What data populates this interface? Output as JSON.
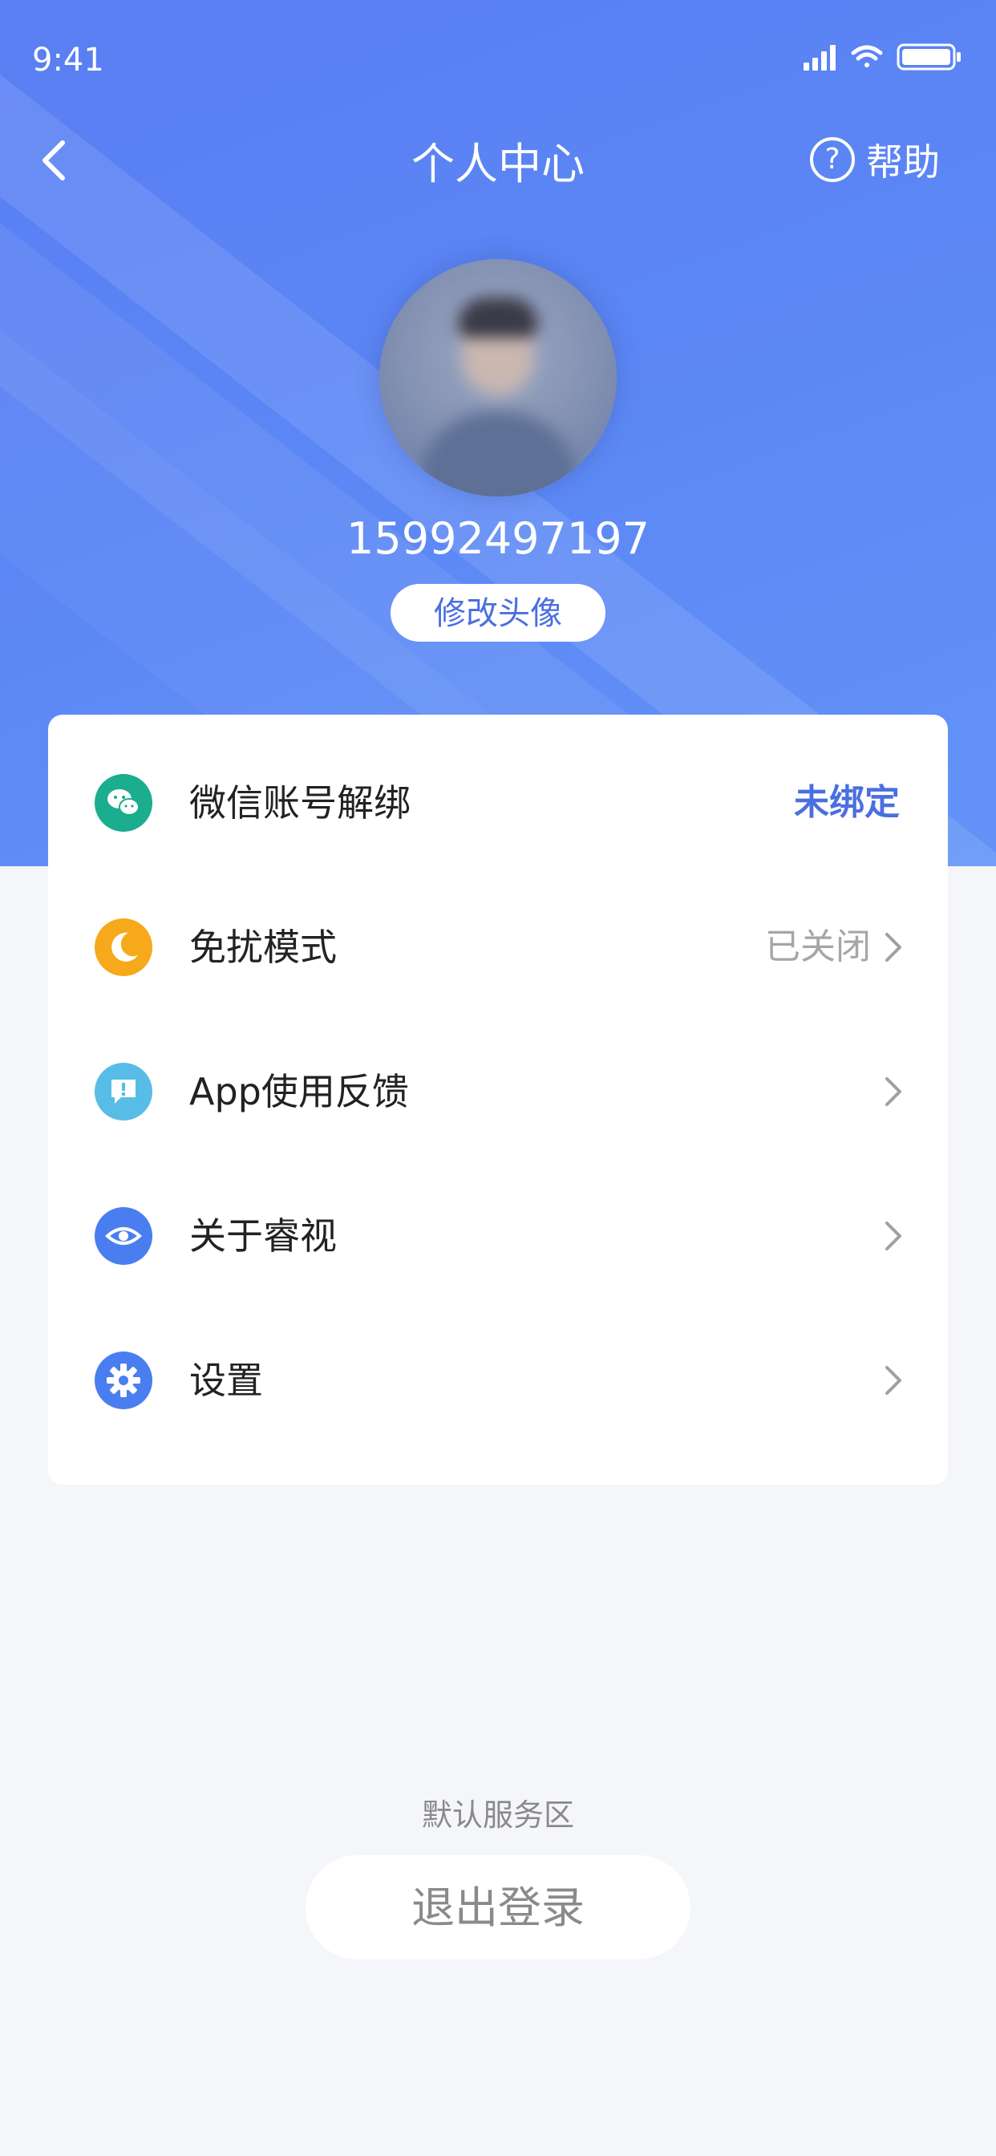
{
  "status_bar": {
    "time": "9:41"
  },
  "nav": {
    "title": "个人中心",
    "help_label": "帮助"
  },
  "profile": {
    "phone": "15992497197",
    "edit_avatar_label": "修改头像"
  },
  "menu": [
    {
      "label": "微信账号解绑",
      "value": "未绑定",
      "icon": "wechat-icon"
    },
    {
      "label": "免扰模式",
      "value": "已关闭",
      "icon": "moon-icon"
    },
    {
      "label": "App使用反馈",
      "value": "",
      "icon": "feedback-icon"
    },
    {
      "label": "关于睿视",
      "value": "",
      "icon": "eye-icon"
    },
    {
      "label": "设置",
      "value": "",
      "icon": "gear-icon"
    }
  ],
  "footer": {
    "service_area": "默认服务区",
    "logout_label": "退出登录"
  },
  "colors": {
    "accent": "#4a6fe0",
    "hero_blue": "#5b86f5",
    "wechat": "#1aad8e",
    "moon": "#f6a91a",
    "feedback": "#57bde6",
    "eye": "#4a7ef0",
    "gear": "#4a7ef0"
  }
}
